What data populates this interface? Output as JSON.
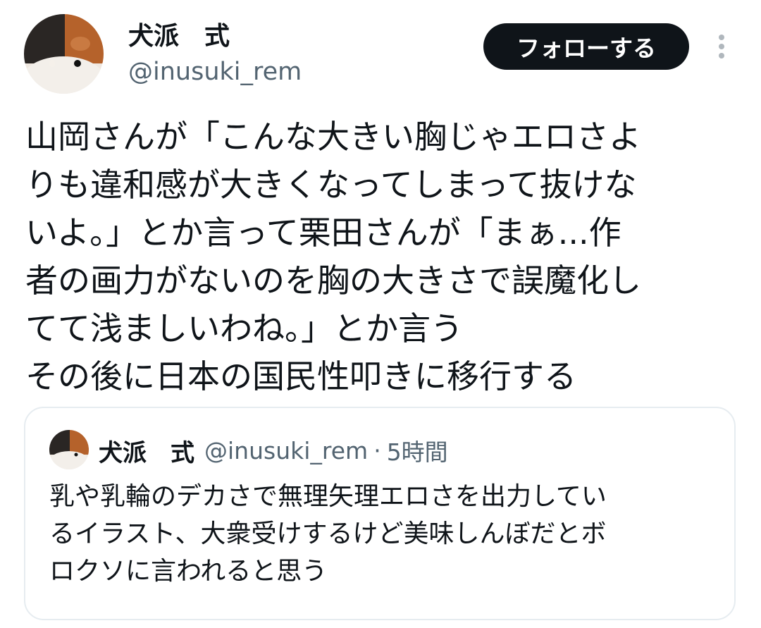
{
  "author": {
    "name": "犬派　式",
    "handle": "@inusuki_rem",
    "avatar_icon": "calico-cat-avatar"
  },
  "follow_button_label": "フォローする",
  "more_icon": "more-vertical-icon",
  "tweet": {
    "lines": [
      "山岡さんが「こんな大きい胸じゃエロさよ",
      "りも違和感が大きくなってしまって抜けな",
      "いよ。」とか言って栗田さんが「まぁ...作",
      "者の画力がないのを胸の大きさで誤魔化し",
      "てて浅ましいわね。」とか言う",
      "その後に日本の国民性叩きに移行する"
    ]
  },
  "quote": {
    "name": "犬派　式",
    "handle": "@inusuki_rem",
    "separator": "·",
    "time": "5時間",
    "lines": [
      "乳や乳輪のデカさで無理矢理エロさを出力してい",
      "るイラスト、大衆受けするけど美味しんぼだとボ",
      "ロクソに言われると思う"
    ]
  },
  "colors": {
    "text_primary": "#0f1419",
    "text_secondary": "#536471",
    "border": "#e6ecf0",
    "follow_bg": "#0f1419"
  }
}
